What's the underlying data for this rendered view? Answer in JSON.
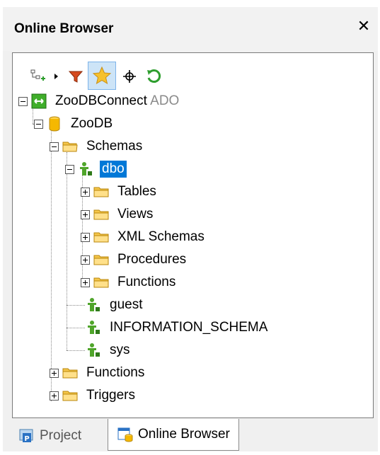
{
  "window": {
    "title": "Online Browser",
    "close_label": "✕"
  },
  "toolbar": {
    "buttons": [
      "add-datasource-icon",
      "filter-icon",
      "favorites-star-icon",
      "locate-icon",
      "refresh-icon"
    ]
  },
  "tree": {
    "connection": {
      "name": "ZooDBConnect",
      "type": "ADO"
    },
    "database": "ZooDB",
    "schemas": "Schemas",
    "dbo": "dbo",
    "dbo_children": [
      "Tables",
      "Views",
      "XML Schemas",
      "Procedures",
      "Functions"
    ],
    "other_schemas": [
      "guest",
      "INFORMATION_SCHEMA",
      "sys"
    ],
    "functions": "Functions",
    "triggers": "Triggers"
  },
  "tabs": {
    "project": "Project",
    "online_browser": "Online Browser"
  },
  "colors": {
    "selection": "#0078d7",
    "folder": "#f5c64a",
    "schema_icon": "#4fa52a",
    "refresh": "#2e9e2e",
    "filter": "#d64a1f",
    "star": "#f6c12c"
  }
}
